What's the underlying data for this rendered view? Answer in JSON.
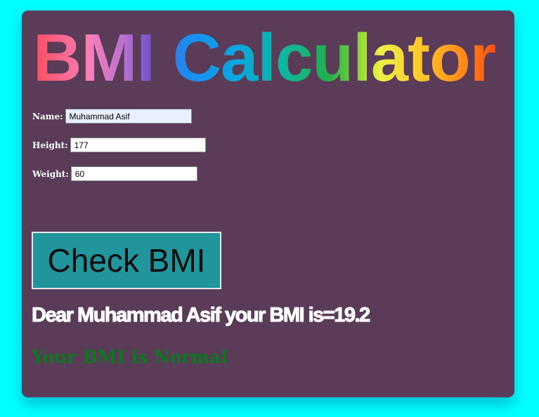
{
  "app": {
    "title": "BMI Calculator"
  },
  "form": {
    "name_label": "Name:",
    "name_value": "Muhammad Asif",
    "height_label": "Height:",
    "height_value": "177",
    "weight_label": "Weight:",
    "weight_value": "60"
  },
  "actions": {
    "check_label": "Check BMI"
  },
  "output": {
    "result_text": "Dear Muhammad Asif your BMI is=19.2",
    "status_text": "Your BMI is Normal"
  },
  "colors": {
    "page_background": "#00ffff",
    "card_background": "#5a3b58",
    "button_background": "#21959c",
    "status_color": "#0b7a1e"
  }
}
